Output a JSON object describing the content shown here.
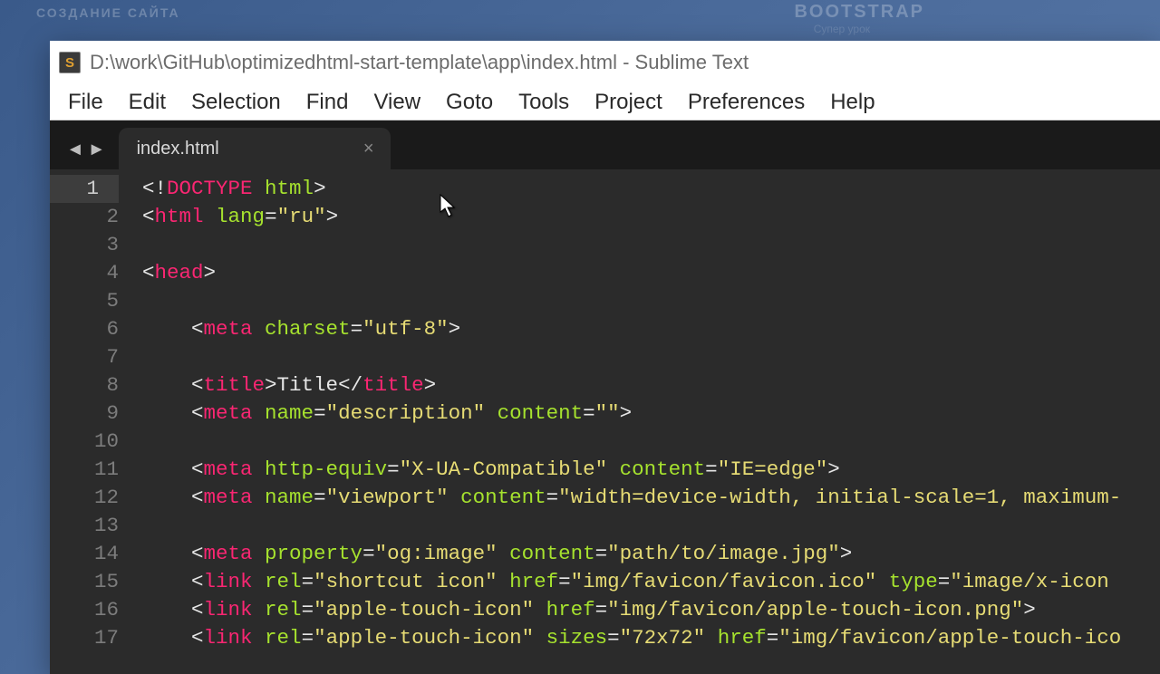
{
  "bg": {
    "left": "СОЗДАНИЕ САЙТА",
    "right": "BOOTSTRAP",
    "right2": "Супер урок"
  },
  "title": "D:\\work\\GitHub\\optimizedhtml-start-template\\app\\index.html - Sublime Text",
  "appIconLetter": "S",
  "menu": [
    "File",
    "Edit",
    "Selection",
    "Find",
    "View",
    "Goto",
    "Tools",
    "Project",
    "Preferences",
    "Help"
  ],
  "tab": {
    "name": "index.html",
    "close": "×"
  },
  "nav": {
    "back": "◄",
    "fwd": "►"
  },
  "lines": {
    "count": 17,
    "active": 1,
    "l1": [
      [
        "p",
        "<!"
      ],
      [
        "kw",
        "DOCTYPE"
      ],
      [
        "p",
        " "
      ],
      [
        "attr",
        "html"
      ],
      [
        "p",
        ">"
      ]
    ],
    "l2": [
      [
        "p",
        "<"
      ],
      [
        "tag",
        "html"
      ],
      [
        "p",
        " "
      ],
      [
        "attr",
        "lang"
      ],
      [
        "p",
        "="
      ],
      [
        "str",
        "\"ru\""
      ],
      [
        "p",
        ">"
      ]
    ],
    "l3": [],
    "l4": [
      [
        "p",
        "<"
      ],
      [
        "tag",
        "head"
      ],
      [
        "p",
        ">"
      ]
    ],
    "l5": [],
    "l6": [
      [
        "p",
        "    <"
      ],
      [
        "tag",
        "meta"
      ],
      [
        "p",
        " "
      ],
      [
        "attr",
        "charset"
      ],
      [
        "p",
        "="
      ],
      [
        "str",
        "\"utf-8\""
      ],
      [
        "p",
        ">"
      ]
    ],
    "l7": [],
    "l8": [
      [
        "p",
        "    <"
      ],
      [
        "tag",
        "title"
      ],
      [
        "p",
        ">"
      ],
      [
        "txt",
        "Title"
      ],
      [
        "p",
        "</"
      ],
      [
        "tag",
        "title"
      ],
      [
        "p",
        ">"
      ]
    ],
    "l9": [
      [
        "p",
        "    <"
      ],
      [
        "tag",
        "meta"
      ],
      [
        "p",
        " "
      ],
      [
        "attr",
        "name"
      ],
      [
        "p",
        "="
      ],
      [
        "str",
        "\"description\""
      ],
      [
        "p",
        " "
      ],
      [
        "attr",
        "content"
      ],
      [
        "p",
        "="
      ],
      [
        "str",
        "\"\""
      ],
      [
        "p",
        ">"
      ]
    ],
    "l10": [],
    "l11": [
      [
        "p",
        "    <"
      ],
      [
        "tag",
        "meta"
      ],
      [
        "p",
        " "
      ],
      [
        "attr",
        "http-equiv"
      ],
      [
        "p",
        "="
      ],
      [
        "str",
        "\"X-UA-Compatible\""
      ],
      [
        "p",
        " "
      ],
      [
        "attr",
        "content"
      ],
      [
        "p",
        "="
      ],
      [
        "str",
        "\"IE=edge\""
      ],
      [
        "p",
        ">"
      ]
    ],
    "l12": [
      [
        "p",
        "    <"
      ],
      [
        "tag",
        "meta"
      ],
      [
        "p",
        " "
      ],
      [
        "attr",
        "name"
      ],
      [
        "p",
        "="
      ],
      [
        "str",
        "\"viewport\""
      ],
      [
        "p",
        " "
      ],
      [
        "attr",
        "content"
      ],
      [
        "p",
        "="
      ],
      [
        "str",
        "\"width=device-width, initial-scale=1, maximum-"
      ]
    ],
    "l13": [],
    "l14": [
      [
        "p",
        "    <"
      ],
      [
        "tag",
        "meta"
      ],
      [
        "p",
        " "
      ],
      [
        "attr",
        "property"
      ],
      [
        "p",
        "="
      ],
      [
        "str",
        "\"og:image\""
      ],
      [
        "p",
        " "
      ],
      [
        "attr",
        "content"
      ],
      [
        "p",
        "="
      ],
      [
        "str",
        "\"path/to/image.jpg\""
      ],
      [
        "p",
        ">"
      ]
    ],
    "l15": [
      [
        "p",
        "    <"
      ],
      [
        "tag",
        "link"
      ],
      [
        "p",
        " "
      ],
      [
        "attr",
        "rel"
      ],
      [
        "p",
        "="
      ],
      [
        "str",
        "\"shortcut icon\""
      ],
      [
        "p",
        " "
      ],
      [
        "attr",
        "href"
      ],
      [
        "p",
        "="
      ],
      [
        "str",
        "\"img/favicon/favicon.ico\""
      ],
      [
        "p",
        " "
      ],
      [
        "attr",
        "type"
      ],
      [
        "p",
        "="
      ],
      [
        "str",
        "\"image/x-icon"
      ]
    ],
    "l16": [
      [
        "p",
        "    <"
      ],
      [
        "tag",
        "link"
      ],
      [
        "p",
        " "
      ],
      [
        "attr",
        "rel"
      ],
      [
        "p",
        "="
      ],
      [
        "str",
        "\"apple-touch-icon\""
      ],
      [
        "p",
        " "
      ],
      [
        "attr",
        "href"
      ],
      [
        "p",
        "="
      ],
      [
        "str",
        "\"img/favicon/apple-touch-icon.png\""
      ],
      [
        "p",
        ">"
      ]
    ],
    "l17": [
      [
        "p",
        "    <"
      ],
      [
        "tag",
        "link"
      ],
      [
        "p",
        " "
      ],
      [
        "attr",
        "rel"
      ],
      [
        "p",
        "="
      ],
      [
        "str",
        "\"apple-touch-icon\""
      ],
      [
        "p",
        " "
      ],
      [
        "attr",
        "sizes"
      ],
      [
        "p",
        "="
      ],
      [
        "str",
        "\"72x72\""
      ],
      [
        "p",
        " "
      ],
      [
        "attr",
        "href"
      ],
      [
        "p",
        "="
      ],
      [
        "str",
        "\"img/favicon/apple-touch-ico"
      ]
    ]
  }
}
